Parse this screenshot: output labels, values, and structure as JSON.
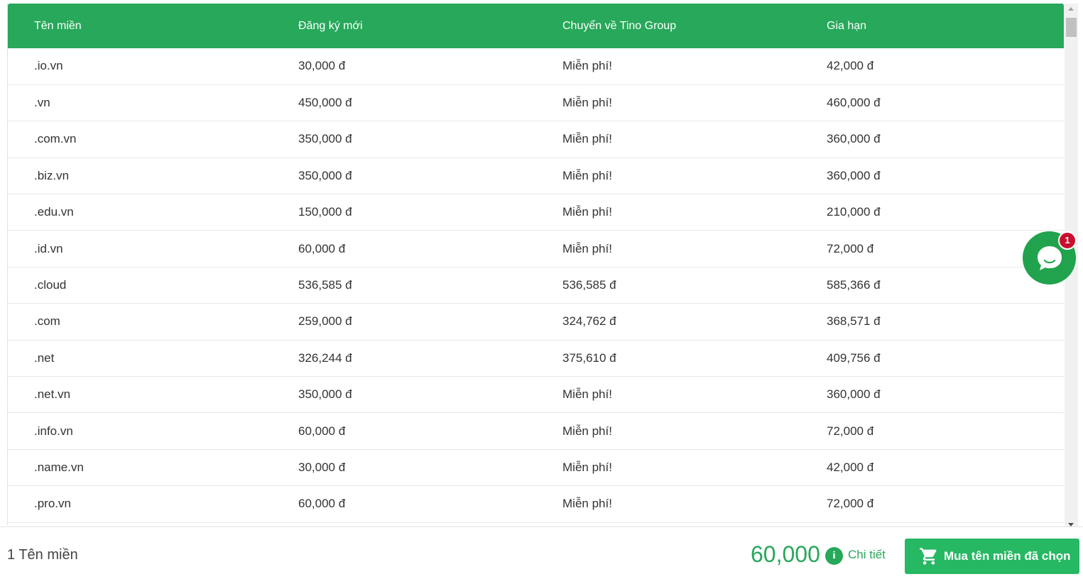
{
  "table": {
    "headers": [
      "Tên miền",
      "Đăng ký mới",
      "Chuyển về Tino Group",
      "Gia hạn"
    ],
    "rows": [
      [
        ".io.vn",
        "30,000 đ",
        "Miễn phí!",
        "42,000 đ"
      ],
      [
        ".vn",
        "450,000 đ",
        "Miễn phí!",
        "460,000 đ"
      ],
      [
        ".com.vn",
        "350,000 đ",
        "Miễn phí!",
        "360,000 đ"
      ],
      [
        ".biz.vn",
        "350,000 đ",
        "Miễn phí!",
        "360,000 đ"
      ],
      [
        ".edu.vn",
        "150,000 đ",
        "Miễn phí!",
        "210,000 đ"
      ],
      [
        ".id.vn",
        "60,000 đ",
        "Miễn phí!",
        "72,000 đ"
      ],
      [
        ".cloud",
        "536,585 đ",
        "536,585 đ",
        "585,366 đ"
      ],
      [
        ".com",
        "259,000 đ",
        "324,762 đ",
        "368,571 đ"
      ],
      [
        ".net",
        "326,244 đ",
        "375,610 đ",
        "409,756 đ"
      ],
      [
        ".net.vn",
        "350,000 đ",
        "Miễn phí!",
        "360,000 đ"
      ],
      [
        ".info.vn",
        "60,000 đ",
        "Miễn phí!",
        "72,000 đ"
      ],
      [
        ".name.vn",
        "30,000 đ",
        "Miễn phí!",
        "42,000 đ"
      ],
      [
        ".pro.vn",
        "60,000 đ",
        "Miễn phí!",
        "72,000 đ"
      ]
    ]
  },
  "chat": {
    "badge_count": "1",
    "icon": "chat-bubble-icon"
  },
  "footer": {
    "count_label": "1 Tên miền",
    "total": "60,000",
    "info_icon_glyph": "i",
    "detail_label": "Chi tiết",
    "buy_label": "Mua tên miền đã chọn"
  },
  "colors": {
    "accent": "#27a85a",
    "button": "#27b864",
    "badge": "#c8102e"
  }
}
